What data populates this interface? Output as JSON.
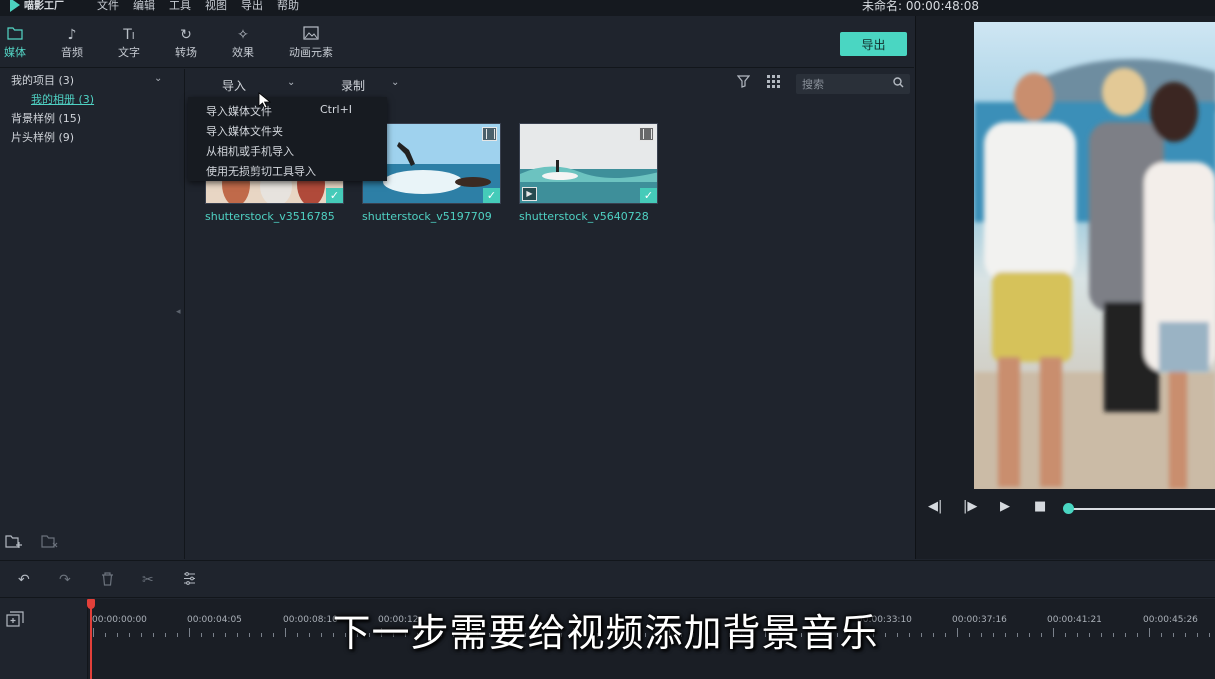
{
  "app": {
    "logo_text": "喵影工厂",
    "menu": [
      "文件",
      "编辑",
      "工具",
      "视图",
      "导出",
      "帮助"
    ],
    "project_title": "未命名: 00:00:48:08"
  },
  "toolbar": {
    "tabs": [
      {
        "label": "媒体",
        "icon": "folder-icon"
      },
      {
        "label": "音频",
        "icon": "music-note-icon"
      },
      {
        "label": "文字",
        "icon": "text-icon"
      },
      {
        "label": "转场",
        "icon": "transition-icon"
      },
      {
        "label": "效果",
        "icon": "effects-icon"
      },
      {
        "label": "动画元素",
        "icon": "image-icon"
      }
    ],
    "export_label": "导出",
    "accent_color": "#4ad6c2"
  },
  "sidebar": {
    "items": [
      {
        "label": "我的项目 (3)"
      },
      {
        "label": "我的相册 (3)"
      },
      {
        "label": "背景样例 (15)"
      },
      {
        "label": "片头样例 (9)"
      }
    ]
  },
  "media": {
    "import_label": "导入",
    "record_label": "录制",
    "search_placeholder": "搜索",
    "clips": [
      {
        "name": "shutterstock_v3516785"
      },
      {
        "name": "shutterstock_v5197709"
      },
      {
        "name": "shutterstock_v5640728"
      }
    ]
  },
  "import_menu": {
    "items": [
      {
        "label": "导入媒体文件",
        "shortcut": "Ctrl+I"
      },
      {
        "label": "导入媒体文件夹",
        "shortcut": ""
      },
      {
        "label": "从相机或手机导入",
        "shortcut": ""
      },
      {
        "label": "使用无损剪切工具导入",
        "shortcut": ""
      }
    ]
  },
  "timeline": {
    "timecodes": [
      "00:00:00:00",
      "00:00:04:05",
      "00:00:08:10",
      "00:00:12",
      "00:00:33:10",
      "00:00:37:16",
      "00:00:41:21",
      "00:00:45:26"
    ]
  },
  "subtitle": "下一步需要给视频添加背景音乐"
}
